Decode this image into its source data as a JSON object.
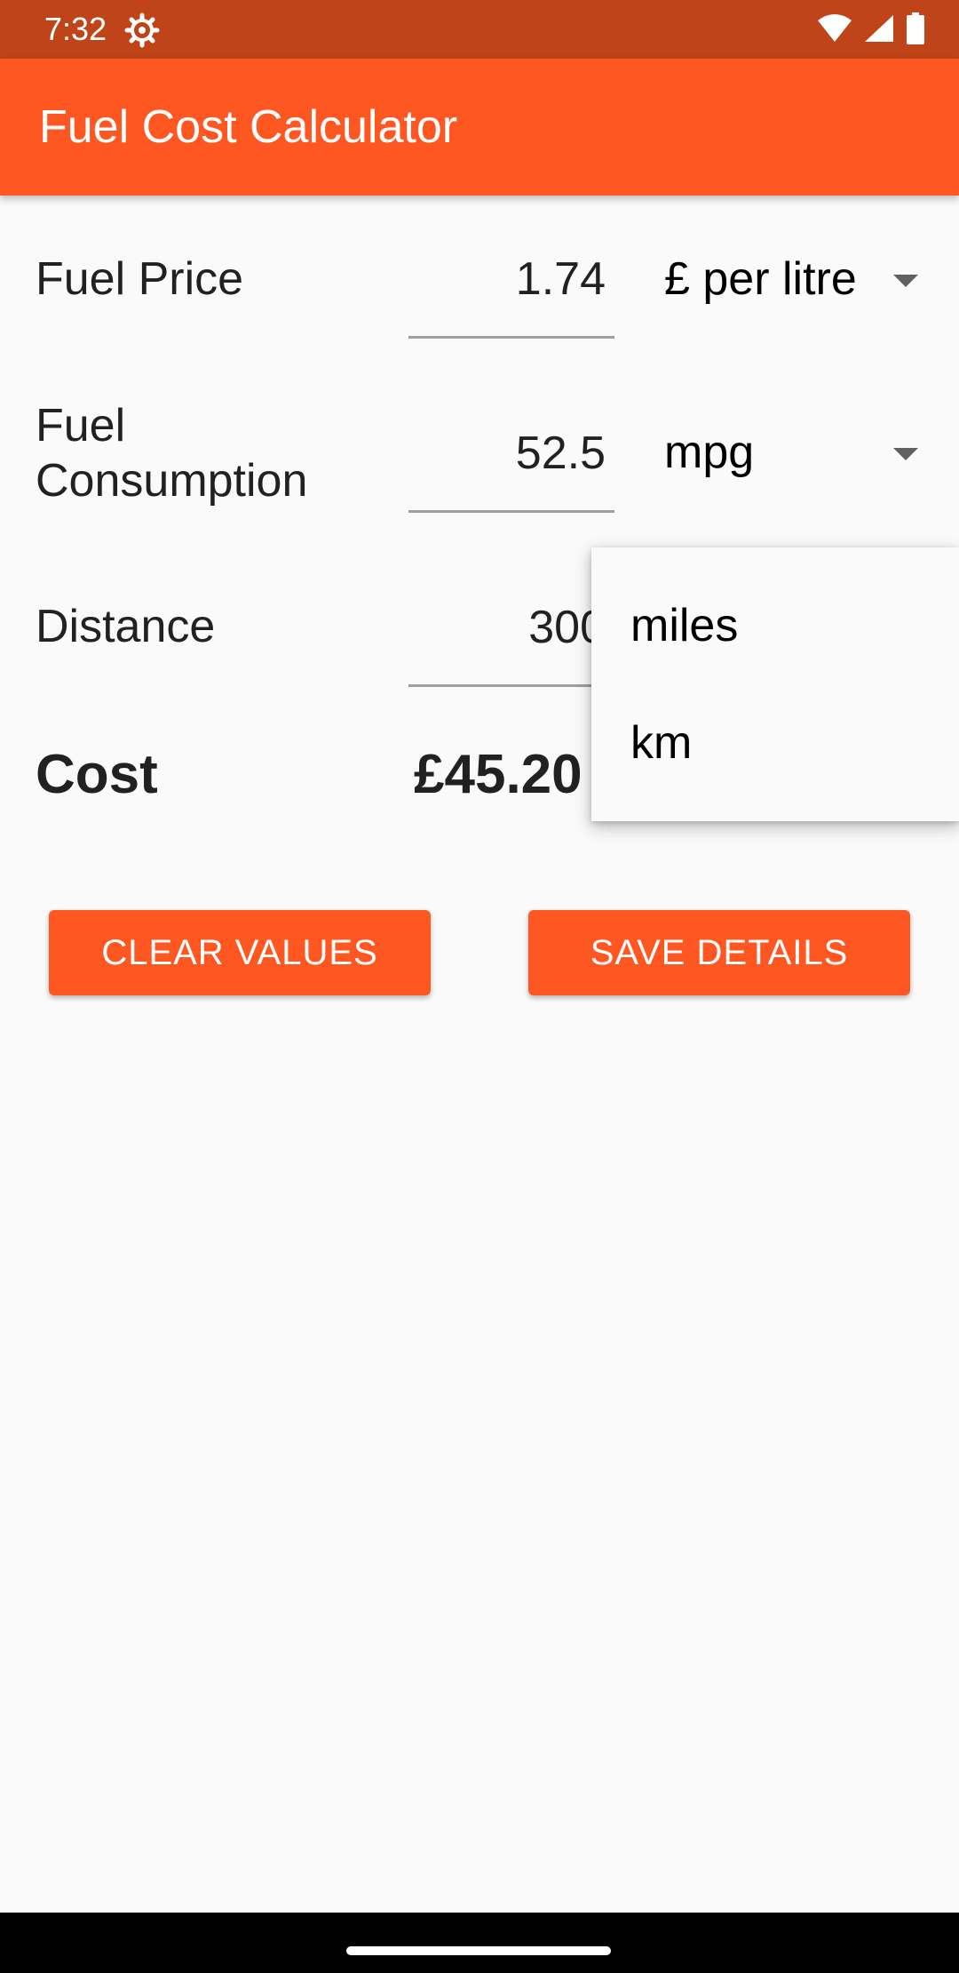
{
  "status_bar": {
    "time": "7:32",
    "icons": [
      "gear-icon",
      "wifi-icon",
      "signal-icon",
      "battery-icon"
    ]
  },
  "app_bar": {
    "title": "Fuel Cost Calculator",
    "color": "#ff5722"
  },
  "form": {
    "fuel_price": {
      "label": "Fuel Price",
      "value": "1.74",
      "unit": "£ per litre"
    },
    "fuel_consumption": {
      "label": "Fuel Consumption",
      "label_line1": "Fuel",
      "label_line2": "Consumption",
      "value": "52.5",
      "unit": "mpg"
    },
    "distance": {
      "label": "Distance",
      "value": "300"
    }
  },
  "result": {
    "label": "Cost",
    "value": "£45.20"
  },
  "buttons": {
    "clear_label": "CLEAR VALUES",
    "save_label": "SAVE DETAILS"
  },
  "distance_unit_menu": {
    "options": [
      "miles",
      "km"
    ]
  },
  "colors": {
    "primary": "#ff5722",
    "primary_dark": "#bf4419",
    "background": "#fafafa"
  }
}
